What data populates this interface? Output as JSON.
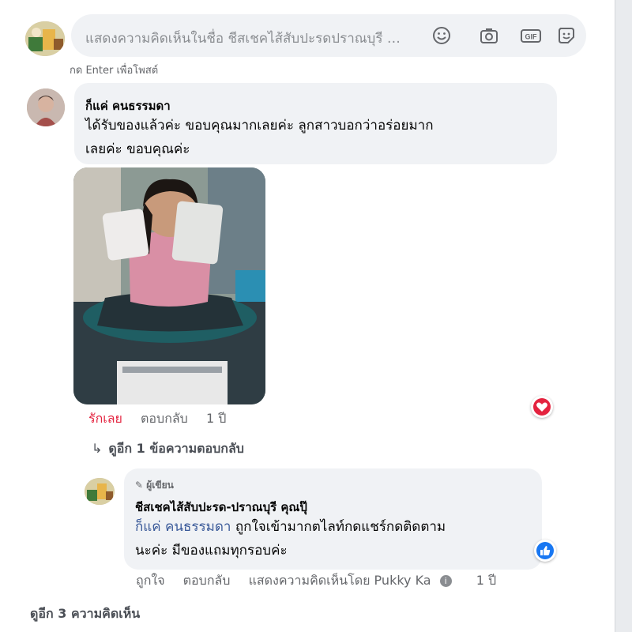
{
  "composer": {
    "placeholder": "แสดงความคิดเห็นในชื่อ ชีสเชคไส้สับปะรดปราณบุรี คุณปุ๊",
    "hint": "กด Enter เพื่อโพสต์",
    "icons": [
      "emoji-icon",
      "camera-icon",
      "gif-icon",
      "sticker-icon"
    ],
    "gif_label": "GIF"
  },
  "comment": {
    "author": "ก็แค่ คนธรรมดา",
    "text_line1": "ได้รับของแล้วค่ะ ขอบคุณมากเลยค่ะ ลูกสาวบอกว่าอร่อยมาก",
    "text_line2": "เลยค่ะ ขอบคุณค่ะ",
    "actions": {
      "love": "รักเลย",
      "reply": "ตอบกลับ",
      "time": "1 ปี"
    },
    "reaction": "love"
  },
  "view_replies": "ดูอีก 1 ข้อความตอบกลับ",
  "reply": {
    "badge": "ผู้เขียน",
    "author": "ชีสเชคไส้สับปะรด-ปราณบุรี คุณปุ๊",
    "mention": "ก็แค่ คนธรรมดา",
    "text_line1": " ถูกใจเข้ามากตไลท์กดแชร์กดติดตาม",
    "text_line2": "นะค่ะ มีของแถมทุกรอบค่ะ",
    "actions": {
      "like": "ถูกใจ",
      "reply": "ตอบกลับ",
      "shown_by": "แสดงความคิดเห็นโดย Pukky Ka",
      "time": "1 ปี"
    },
    "reaction": "like"
  },
  "more_comments": "ดูอีก 3 ความคิดเห็น",
  "colors": {
    "love": "#e4233f",
    "like": "#1877f2",
    "link": "#385898",
    "bubble": "#f0f2f5"
  }
}
